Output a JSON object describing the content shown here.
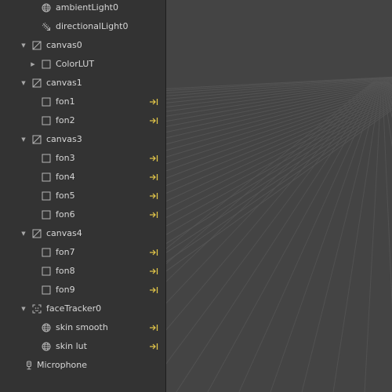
{
  "scene_tree": {
    "items": [
      {
        "label": "ambientLight0",
        "icon": "globe-icon",
        "depth": 1,
        "arrow": "none",
        "link": false
      },
      {
        "label": "directionalLight0",
        "icon": "directional-light-icon",
        "depth": 1,
        "arrow": "none",
        "link": false
      },
      {
        "label": "canvas0",
        "icon": "canvas-icon",
        "depth": 0,
        "arrow": "expanded",
        "link": false
      },
      {
        "label": "ColorLUT",
        "icon": "rectangle-icon",
        "depth": 1,
        "arrow": "collapsed",
        "link": false
      },
      {
        "label": "canvas1",
        "icon": "canvas-icon",
        "depth": 0,
        "arrow": "expanded",
        "link": false
      },
      {
        "label": "fon1",
        "icon": "rectangle-icon",
        "depth": 1,
        "arrow": "none",
        "link": true
      },
      {
        "label": "fon2",
        "icon": "rectangle-icon",
        "depth": 1,
        "arrow": "none",
        "link": true
      },
      {
        "label": "canvas3",
        "icon": "canvas-icon",
        "depth": 0,
        "arrow": "expanded",
        "link": false
      },
      {
        "label": "fon3",
        "icon": "rectangle-icon",
        "depth": 1,
        "arrow": "none",
        "link": true
      },
      {
        "label": "fon4",
        "icon": "rectangle-icon",
        "depth": 1,
        "arrow": "none",
        "link": true
      },
      {
        "label": "fon5",
        "icon": "rectangle-icon",
        "depth": 1,
        "arrow": "none",
        "link": true
      },
      {
        "label": "fon6",
        "icon": "rectangle-icon",
        "depth": 1,
        "arrow": "none",
        "link": true
      },
      {
        "label": "canvas4",
        "icon": "canvas-icon",
        "depth": 0,
        "arrow": "expanded",
        "link": false
      },
      {
        "label": "fon7",
        "icon": "rectangle-icon",
        "depth": 1,
        "arrow": "none",
        "link": true
      },
      {
        "label": "fon8",
        "icon": "rectangle-icon",
        "depth": 1,
        "arrow": "none",
        "link": true
      },
      {
        "label": "fon9",
        "icon": "rectangle-icon",
        "depth": 1,
        "arrow": "none",
        "link": true
      },
      {
        "label": "faceTracker0",
        "icon": "face-tracker-icon",
        "depth": 0,
        "arrow": "expanded",
        "link": false
      },
      {
        "label": "skin smooth",
        "icon": "shader-sphere-icon",
        "depth": 1,
        "arrow": "none",
        "link": true
      },
      {
        "label": "skin lut",
        "icon": "shader-sphere-icon",
        "depth": 1,
        "arrow": "none",
        "link": true
      },
      {
        "label": "Microphone",
        "icon": "microphone-icon",
        "depth": -1,
        "arrow": "none",
        "link": false
      }
    ]
  },
  "colors": {
    "panel_bg": "#333333",
    "viewport_bg": "#444444",
    "grid_line": "#555555",
    "link_icon": "#e6c94a",
    "text": "#d6d6d6"
  }
}
